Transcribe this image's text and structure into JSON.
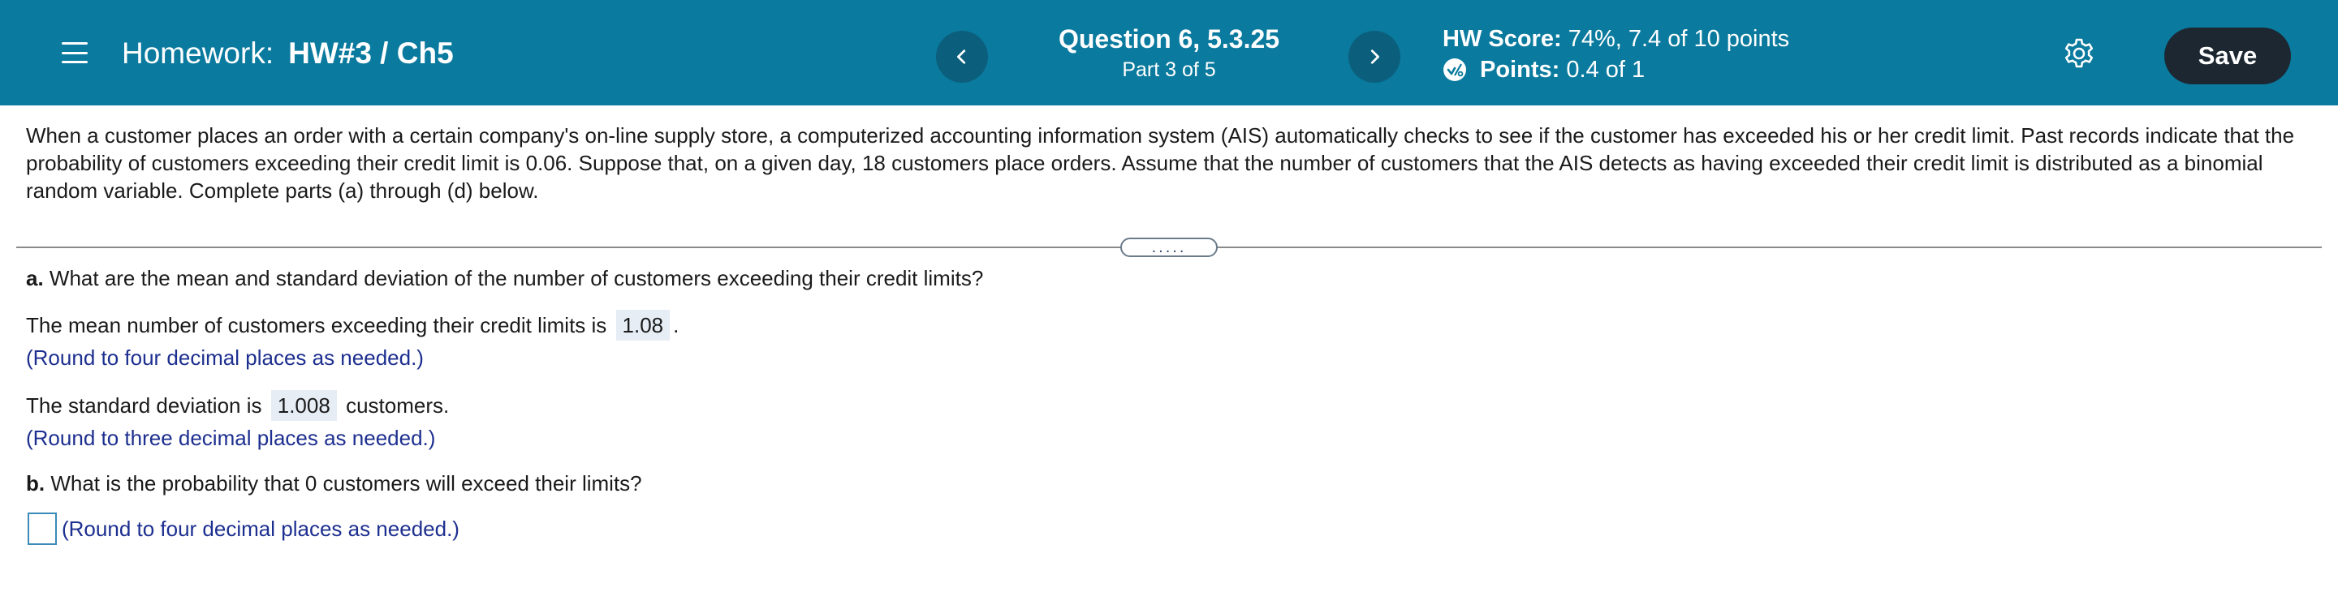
{
  "header": {
    "homework_prefix": "Homework:",
    "homework_name": "HW#3 / Ch5",
    "question_title": "Question 6, 5.3.25",
    "question_part": "Part 3 of 5",
    "hw_score_label": "HW Score:",
    "hw_score_value": "74%, 7.4 of 10 points",
    "points_label": "Points:",
    "points_value": "0.4 of 1",
    "save_label": "Save",
    "background_color": "#0a7a9e",
    "save_color": "#1c2731"
  },
  "problem": {
    "text": "When a customer places an order with a certain company's on-line supply store, a computerized accounting information system (AIS) automatically checks to see if the customer has exceeded his or her credit limit. Past records indicate that the probability of customers exceeding their credit limit is 0.06. Suppose that, on a given day, 18 customers place orders. Assume that the number of customers that the AIS detects as having exceeded their credit limit is distributed as a binomial random variable. Complete parts (a) through (d) below."
  },
  "divider": {
    "handle_label": "....."
  },
  "part_a": {
    "label": "a.",
    "question": " What are the mean and standard deviation of the number of customers exceeding their credit limits?",
    "mean_prefix": "The mean number of customers exceeding their credit limits is",
    "mean_value": "1.08",
    "mean_suffix": ".",
    "mean_hint": "(Round to four decimal places as needed.)",
    "sd_prefix": "The standard deviation is",
    "sd_value": "1.008",
    "sd_suffix": "customers.",
    "sd_hint": "(Round to three decimal places as needed.)"
  },
  "part_b": {
    "label": "b.",
    "question": " What is the probability that 0 customers will exceed their limits?",
    "answer_value": "",
    "hint": "(Round to four decimal places as needed.)"
  }
}
